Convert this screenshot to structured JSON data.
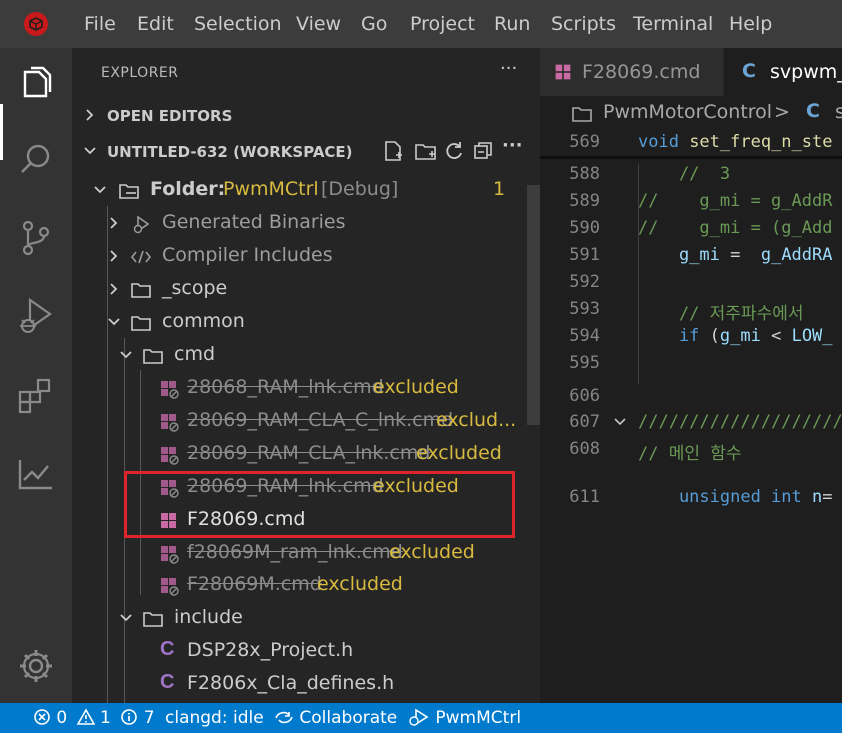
{
  "menu": [
    "File",
    "Edit",
    "Selection",
    "View",
    "Go",
    "Project",
    "Run",
    "Scripts",
    "Terminal",
    "Help"
  ],
  "activity": {
    "items": [
      "explorer-icon",
      "search-icon",
      "source-control-icon",
      "run-debug-icon",
      "extensions-icon",
      "chart-icon",
      "settings-gear-icon"
    ]
  },
  "sidebar": {
    "title": "EXPLORER",
    "more": "···",
    "open_editors": "OPEN EDITORS",
    "workspace": "UNTITLED-632 (WORKSPACE)",
    "folder": {
      "prefix": "Folder:",
      "name": "PwmMCtrl",
      "config": "[Debug]",
      "badge": "1"
    },
    "tree": [
      {
        "label": "Generated Binaries"
      },
      {
        "label": "Compiler Includes"
      },
      {
        "label": "_scope"
      },
      {
        "label": "common"
      },
      {
        "label": "cmd"
      },
      {
        "label": "28068_RAM_lnk.cmd",
        "tag": "excluded"
      },
      {
        "label": "28069_RAM_CLA_C_lnk.cmd",
        "tag": "exclud..."
      },
      {
        "label": "28069_RAM_CLA_lnk.cmd",
        "tag": "excluded"
      },
      {
        "label": "28069_RAM_lnk.cmd",
        "tag": "excluded"
      },
      {
        "label": "F28069.cmd"
      },
      {
        "label": "f28069M_ram_lnk.cmd",
        "tag": "excluded"
      },
      {
        "label": "F28069M.cmd",
        "tag": "excluded"
      },
      {
        "label": "include"
      },
      {
        "label": "DSP28x_Project.h",
        "icon": "C"
      },
      {
        "label": "F2806x_Cla_defines.h",
        "icon": "C"
      }
    ]
  },
  "editor": {
    "tabs": [
      {
        "label": "F28069.cmd"
      },
      {
        "label": "svpwm_"
      }
    ],
    "tab_c_icon": "C",
    "breadcrumb": {
      "folder": "PwmMotorControl",
      "sep": ">",
      "file_icon": "C",
      "file": "s"
    },
    "lines": [
      {
        "n": "569",
        "parts": [
          [
            "kw",
            "void "
          ],
          [
            "fn",
            "set_freq_n_ste"
          ]
        ]
      },
      {
        "n": "588",
        "parts": [
          [
            "cm",
            "    //  3"
          ]
        ]
      },
      {
        "n": "589",
        "parts": [
          [
            "cm",
            "//    g_mi = g_AddR"
          ]
        ]
      },
      {
        "n": "590",
        "parts": [
          [
            "cm",
            "//    g_mi = (g_Add"
          ]
        ]
      },
      {
        "n": "591",
        "parts": [
          [
            "var",
            "    g_mi"
          ],
          [
            "pl",
            " =  "
          ],
          [
            "var",
            "g_AddRA"
          ]
        ]
      },
      {
        "n": "592",
        "parts": []
      },
      {
        "n": "593",
        "parts": [
          [
            "cm",
            "    // 저주파수에서"
          ]
        ]
      },
      {
        "n": "594",
        "parts": [
          [
            "kw",
            "    if "
          ],
          [
            "pl",
            "("
          ],
          [
            "var",
            "g_mi"
          ],
          [
            "pl",
            " < "
          ],
          [
            "var",
            "LOW_"
          ]
        ]
      },
      {
        "n": "595",
        "parts": []
      },
      {
        "n": "606",
        "parts": []
      },
      {
        "n": "607",
        "parts": [
          [
            "cm",
            "////////////////////"
          ]
        ]
      },
      {
        "n": "608",
        "parts": [
          [
            "cm",
            "// 메인 함수"
          ]
        ]
      },
      {
        "n": "611",
        "parts": [
          [
            "kw",
            "    unsigned int "
          ],
          [
            "var",
            "n"
          ],
          [
            "pl",
            "="
          ]
        ]
      }
    ]
  },
  "status": {
    "errors": "0",
    "warnings": "1",
    "infos": "7",
    "clangd": "clangd: idle",
    "collaborate": "Collaborate",
    "project": "PwmMCtrl"
  }
}
